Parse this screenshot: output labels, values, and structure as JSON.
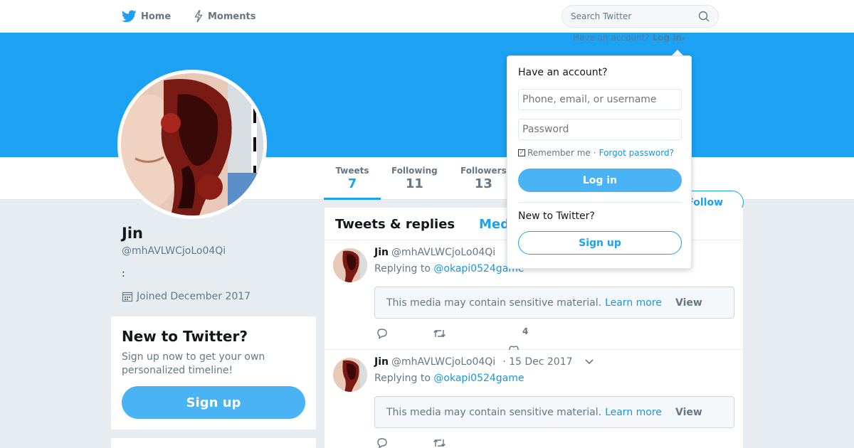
{
  "nav": {
    "home_label": "Home",
    "moments_label": "Moments",
    "search_placeholder": "Search Twitter",
    "have_account": "Have an account?",
    "login_label": "Log in"
  },
  "profile": {
    "name": "Jin",
    "handle": "@mhAVLWCjoLo04Qi",
    "bio": ":",
    "joined": "Joined December 2017",
    "follow_label": "Follow",
    "stats": [
      {
        "label": "Tweets",
        "value": "7"
      },
      {
        "label": "Following",
        "value": "11"
      },
      {
        "label": "Followers",
        "value": "13"
      }
    ]
  },
  "new_card": {
    "title": "New to Twitter?",
    "text": "Sign up now to get your own personalized timeline!",
    "signup_label": "Sign up"
  },
  "timeline": {
    "tab_tweets_replies": "Tweets & replies",
    "tab_media": "Media",
    "tweets": [
      {
        "name": "Jin",
        "handle": "@mhAVLWCjoLo04Qi",
        "date": "",
        "replying_prefix": "Replying to",
        "replying_to": "@okapi0524game",
        "sensitive_text": "This media may contain sensitive material.",
        "learn_more": "Learn more",
        "view": "View",
        "likes": "4"
      },
      {
        "name": "Jin",
        "handle": "@mhAVLWCjoLo04Qi",
        "date": "· 15 Dec 2017",
        "replying_prefix": "Replying to",
        "replying_to": "@okapi0524game",
        "sensitive_text": "This media may contain sensitive material.",
        "learn_more": "Learn more",
        "view": "View",
        "likes": ""
      }
    ]
  },
  "login_dropdown": {
    "title": "Have an account?",
    "username_placeholder": "Phone, email, or username",
    "password_placeholder": "Password",
    "remember_me": "Remember me",
    "separator": "·",
    "forgot_password": "Forgot password?",
    "login_label": "Log in",
    "new_to_twitter": "New to Twitter?",
    "signup_label": "Sign up"
  },
  "colors": {
    "brand_blue": "#1da1f2",
    "button_blue": "#4ab3f4",
    "background": "#e6ecf0"
  }
}
